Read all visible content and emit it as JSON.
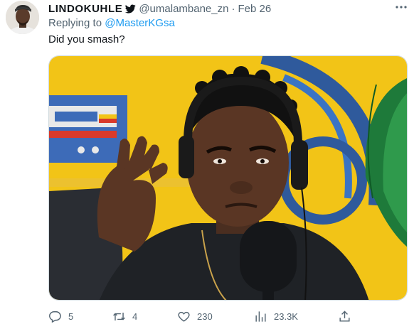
{
  "tweet": {
    "display_name": "LINDOKUHLE",
    "handle": "@umalambane_zn",
    "separator": "·",
    "date": "Feb 26",
    "replying_prefix": "Replying to ",
    "replying_to": "@MasterKGsa",
    "text": "Did you smash?"
  },
  "actions": {
    "replies": "5",
    "retweets": "4",
    "likes": "230",
    "views": "23.3K"
  },
  "icons": {
    "verified": "twitter-bird-icon",
    "more": "more-horizontal-icon",
    "reply": "reply-icon",
    "retweet": "retweet-icon",
    "like": "heart-icon",
    "views": "views-chart-icon",
    "share": "share-icon"
  },
  "colors": {
    "accent": "#1d9bf0",
    "secondary_text": "#536471",
    "primary_text": "#0f1419",
    "border": "#cfd9de"
  }
}
